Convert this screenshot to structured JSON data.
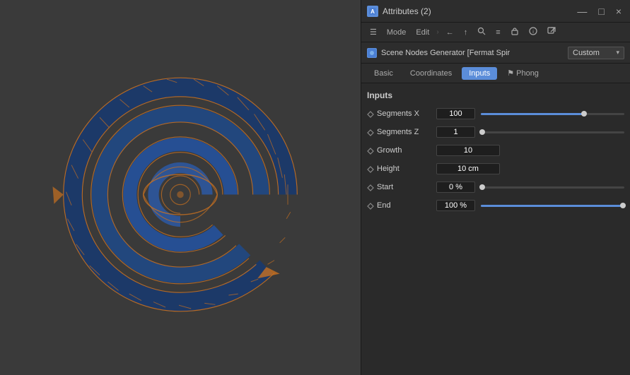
{
  "viewport": {
    "spiral": "fermat-spiral-3d"
  },
  "panel": {
    "title": "Attributes (2)",
    "title_icon": "A",
    "controls": {
      "minimize": "—",
      "maximize": "□",
      "close": "×"
    },
    "toolbar": {
      "hamburger": "☰",
      "mode": "Mode",
      "edit": "Edit",
      "chevron": "›",
      "back": "←",
      "forward": "↑",
      "search": "🔍",
      "list": "≡",
      "lock": "🔒",
      "info": "ⓘ",
      "external": "⬚"
    },
    "scene_node": {
      "label": "Scene Nodes Generator [Fermat Spir",
      "dropdown_label": "Custom",
      "dropdown_arrow": "▾"
    },
    "tabs": [
      {
        "id": "basic",
        "label": "Basic",
        "active": false
      },
      {
        "id": "coordinates",
        "label": "Coordinates",
        "active": false
      },
      {
        "id": "inputs",
        "label": "Inputs",
        "active": true
      },
      {
        "id": "phong",
        "label": "⚑ Phong",
        "active": false
      }
    ],
    "inputs_title": "Inputs",
    "params": [
      {
        "id": "segments_x",
        "label": "Segments X",
        "value": "100",
        "has_slider": true,
        "fill_pct": 72,
        "thumb_pct": 72
      },
      {
        "id": "segments_z",
        "label": "Segments Z",
        "value": "1",
        "has_slider": true,
        "fill_pct": 1,
        "thumb_pct": 1
      },
      {
        "id": "growth",
        "label": "Growth",
        "value": "10",
        "has_slider": false
      },
      {
        "id": "height",
        "label": "Height",
        "value": "10 cm",
        "has_slider": false
      },
      {
        "id": "start",
        "label": "Start",
        "value": "0 %",
        "has_slider": true,
        "fill_pct": 0,
        "thumb_pct": 1
      },
      {
        "id": "end",
        "label": "End",
        "value": "100 %",
        "has_slider": true,
        "fill_pct": 99,
        "thumb_pct": 99
      }
    ]
  }
}
